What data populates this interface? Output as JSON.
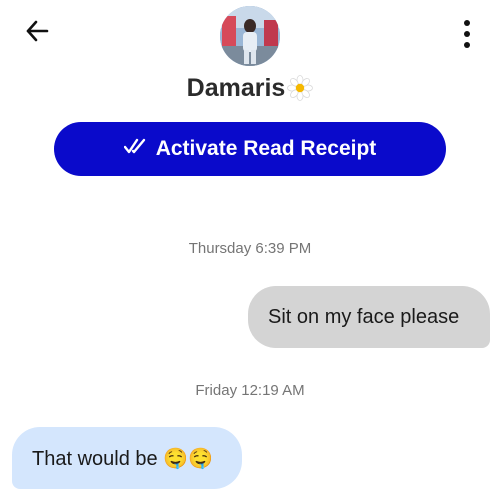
{
  "header": {
    "back_icon": "arrow-left-icon",
    "more_icon": "more-vertical-icon",
    "contact_name": "Damaris",
    "name_emoji": "daisy-icon",
    "avatar_icon": "profile-photo"
  },
  "read_receipt": {
    "label": "Activate Read Receipt",
    "icon": "double-check-icon",
    "color": "#0a0acb"
  },
  "messages": [
    {
      "timestamp": "Thursday 6:39 PM",
      "direction": "outgoing",
      "text": "Sit on my face please",
      "bubble_color": "#d4d4d4"
    },
    {
      "timestamp": "Friday 12:19 AM",
      "direction": "incoming",
      "text": "That would be 🤤🤤",
      "bubble_color": "#d4e6fd"
    }
  ]
}
